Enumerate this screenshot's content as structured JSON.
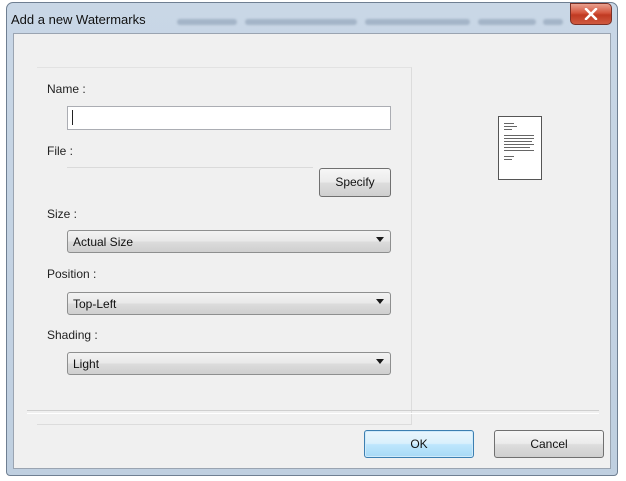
{
  "window": {
    "title": "Add a new Watermarks",
    "close_label": "x"
  },
  "form": {
    "name_label": "Name :",
    "name_value": "",
    "file_label": "File :",
    "specify_label": "Specify",
    "size_label": "Size :",
    "size_selected": "Actual Size",
    "position_label": "Position :",
    "position_selected": "Top-Left",
    "shading_label": "Shading :",
    "shading_selected": "Light"
  },
  "buttons": {
    "ok_label": "OK",
    "cancel_label": "Cancel"
  },
  "icons": {
    "close": "close-icon",
    "dropdown": "chevron-down-icon",
    "preview": "page-preview-icon"
  },
  "colors": {
    "title_bar": "#c9d7e6",
    "client_bg": "#f0f0f0",
    "close_button": "#c03a22",
    "default_button_border": "#3c7fb1"
  }
}
